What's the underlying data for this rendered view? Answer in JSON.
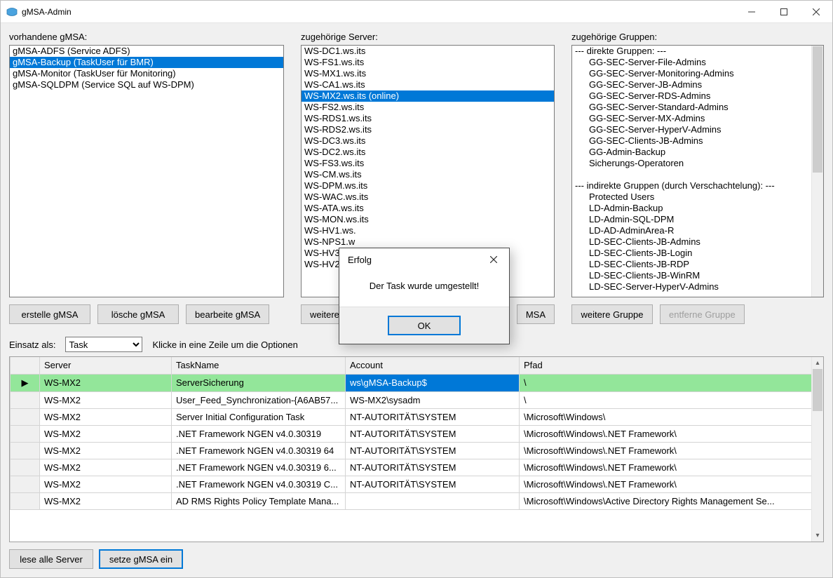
{
  "window": {
    "title": "gMSA-Admin"
  },
  "labels": {
    "col_gmsa": "vorhandene gMSA:",
    "col_servers": "zugehörige Server:",
    "col_groups": "zugehörige Gruppen:",
    "einsatz_als": "Einsatz als:",
    "hint": "Klicke in eine Zeile um die Optionen"
  },
  "buttons": {
    "create_gmsa": "erstelle gMSA",
    "delete_gmsa": "lösche gMSA",
    "edit_gmsa": "bearbeite gMSA",
    "more_server_a": "weiterer S",
    "more_server_b": "MSA",
    "more_group": "weitere Gruppe",
    "remove_group": "entferne Gruppe",
    "read_all": "lese alle Server",
    "set_gmsa": "setze gMSA ein"
  },
  "einsatz_options": [
    "Task"
  ],
  "einsatz_selected": "Task",
  "gmsa_list": {
    "items": [
      "gMSA-ADFS (Service ADFS)",
      "gMSA-Backup (TaskUser für BMR)",
      "gMSA-Monitor (TaskUser für Monitoring)",
      "gMSA-SQLDPM (Service SQL auf WS-DPM)"
    ],
    "selected_index": 1
  },
  "servers_list": {
    "items": [
      "WS-DC1.ws.its",
      "WS-FS1.ws.its",
      "WS-MX1.ws.its",
      "WS-CA1.ws.its",
      "WS-MX2.ws.its (online)",
      "WS-FS2.ws.its",
      "WS-RDS1.ws.its",
      "WS-RDS2.ws.its",
      "WS-DC3.ws.its",
      "WS-DC2.ws.its",
      "WS-FS3.ws.its",
      "WS-CM.ws.its",
      "WS-DPM.ws.its",
      "WS-WAC.ws.its",
      "WS-ATA.ws.its",
      "WS-MON.ws.its",
      "WS-HV1.ws.",
      "WS-NPS1.w",
      "WS-HV3.ws.",
      "WS-HV2.ws."
    ],
    "selected_index": 4
  },
  "groups_list": {
    "items": [
      {
        "text": "--- direkte Gruppen: ---",
        "indent": false
      },
      {
        "text": "GG-SEC-Server-File-Admins",
        "indent": true
      },
      {
        "text": "GG-SEC-Server-Monitoring-Admins",
        "indent": true
      },
      {
        "text": "GG-SEC-Server-JB-Admins",
        "indent": true
      },
      {
        "text": "GG-SEC-Server-RDS-Admins",
        "indent": true
      },
      {
        "text": "GG-SEC-Server-Standard-Admins",
        "indent": true
      },
      {
        "text": "GG-SEC-Server-MX-Admins",
        "indent": true
      },
      {
        "text": "GG-SEC-Server-HyperV-Admins",
        "indent": true
      },
      {
        "text": "GG-SEC-Clients-JB-Admins",
        "indent": true
      },
      {
        "text": "GG-Admin-Backup",
        "indent": true
      },
      {
        "text": "Sicherungs-Operatoren",
        "indent": true
      },
      {
        "text": "",
        "indent": false
      },
      {
        "text": "--- indirekte Gruppen (durch Verschachtelung): ---",
        "indent": false
      },
      {
        "text": "Protected Users",
        "indent": true
      },
      {
        "text": "LD-Admin-Backup",
        "indent": true
      },
      {
        "text": "LD-Admin-SQL-DPM",
        "indent": true
      },
      {
        "text": "LD-AD-AdminArea-R",
        "indent": true
      },
      {
        "text": "LD-SEC-Clients-JB-Admins",
        "indent": true
      },
      {
        "text": "LD-SEC-Clients-JB-Login",
        "indent": true
      },
      {
        "text": "LD-SEC-Clients-JB-RDP",
        "indent": true
      },
      {
        "text": "LD-SEC-Clients-JB-WinRM",
        "indent": true
      },
      {
        "text": "LD-SEC-Server-HyperV-Admins",
        "indent": true
      }
    ]
  },
  "grid": {
    "headers": {
      "server": "Server",
      "task": "TaskName",
      "account": "Account",
      "pfad": "Pfad"
    },
    "rows": [
      {
        "server": "WS-MX2",
        "task": "ServerSicherung",
        "account": "ws\\gMSA-Backup$",
        "pfad": "\\",
        "highlight": true,
        "current": true
      },
      {
        "server": "WS-MX2",
        "task": "User_Feed_Synchronization-{A6AB57...",
        "account": "WS-MX2\\sysadm",
        "pfad": "\\"
      },
      {
        "server": "WS-MX2",
        "task": "Server Initial Configuration Task",
        "account": "NT-AUTORITÄT\\SYSTEM",
        "pfad": "\\Microsoft\\Windows\\"
      },
      {
        "server": "WS-MX2",
        "task": ".NET Framework NGEN v4.0.30319",
        "account": "NT-AUTORITÄT\\SYSTEM",
        "pfad": "\\Microsoft\\Windows\\.NET Framework\\"
      },
      {
        "server": "WS-MX2",
        "task": ".NET Framework NGEN v4.0.30319 64",
        "account": "NT-AUTORITÄT\\SYSTEM",
        "pfad": "\\Microsoft\\Windows\\.NET Framework\\"
      },
      {
        "server": "WS-MX2",
        "task": ".NET Framework NGEN v4.0.30319 6...",
        "account": "NT-AUTORITÄT\\SYSTEM",
        "pfad": "\\Microsoft\\Windows\\.NET Framework\\"
      },
      {
        "server": "WS-MX2",
        "task": ".NET Framework NGEN v4.0.30319 C...",
        "account": "NT-AUTORITÄT\\SYSTEM",
        "pfad": "\\Microsoft\\Windows\\.NET Framework\\"
      },
      {
        "server": "WS-MX2",
        "task": "AD RMS Rights Policy Template Mana...",
        "account": "",
        "pfad": "\\Microsoft\\Windows\\Active Directory Rights Management Se..."
      }
    ]
  },
  "modal": {
    "title": "Erfolg",
    "body": "Der Task wurde umgestellt!",
    "ok": "OK"
  }
}
